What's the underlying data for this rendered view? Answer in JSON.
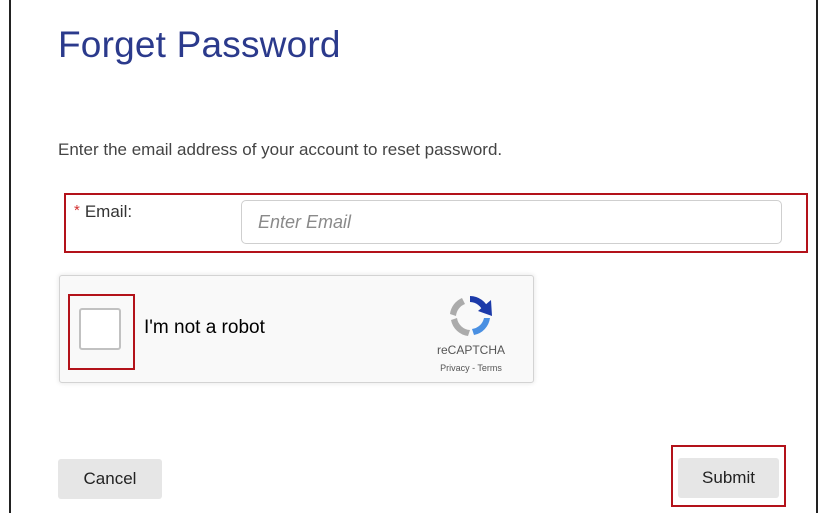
{
  "page": {
    "title": "Forget Password",
    "instructions": "Enter the email address of your account to reset password."
  },
  "email": {
    "required_marker": "*",
    "label": "Email:",
    "placeholder": "Enter Email",
    "value": ""
  },
  "captcha": {
    "checkbox_label": "I'm not a robot",
    "brand": "reCAPTCHA",
    "links": "Privacy - Terms",
    "icon": "recaptcha-logo-icon",
    "checked": false
  },
  "actions": {
    "cancel_label": "Cancel",
    "submit_label": "Submit"
  },
  "colors": {
    "title": "#2b3a8c",
    "highlight": "#b3121a",
    "required": "#d32f2f",
    "button_bg": "#e6e6e6"
  }
}
